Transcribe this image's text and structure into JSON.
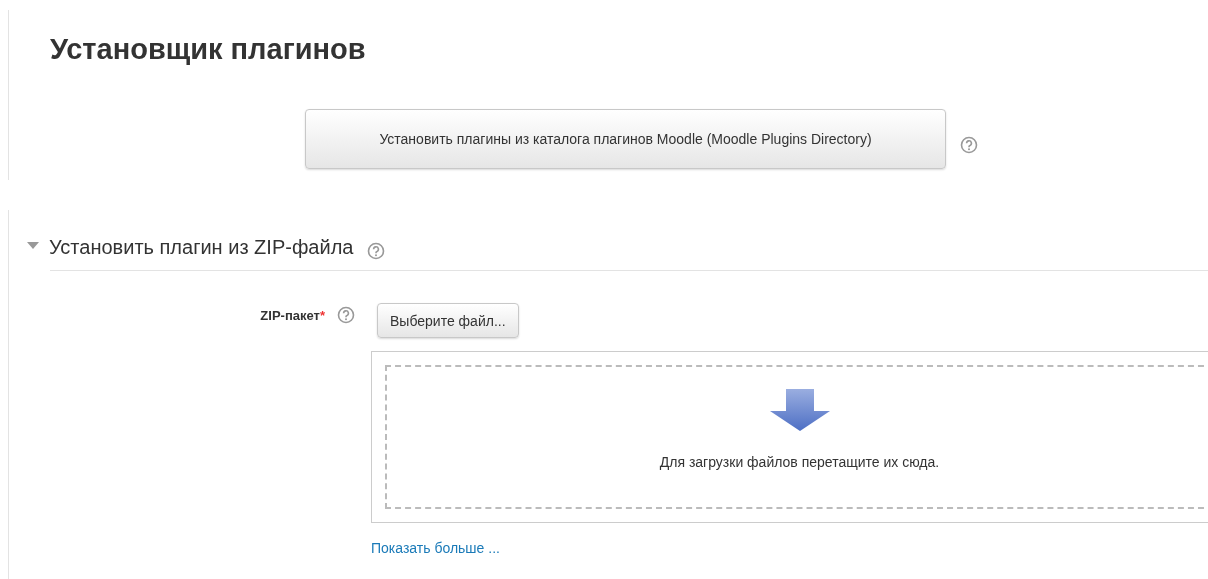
{
  "page_title": "Установщик плагинов",
  "directory_button": {
    "label": "Установить плагины из каталога плагинов Moodle (Moodle Plugins Directory)"
  },
  "zip_section": {
    "title": "Установить плагин из ZIP-файла",
    "expanded": true,
    "field": {
      "label": "ZIP-пакет",
      "required": true,
      "required_mark": "*",
      "choose_button": "Выберите файл...",
      "drop_hint": "Для загрузки файлов перетащите их сюда."
    },
    "show_more_link": "Показать больше ..."
  }
}
